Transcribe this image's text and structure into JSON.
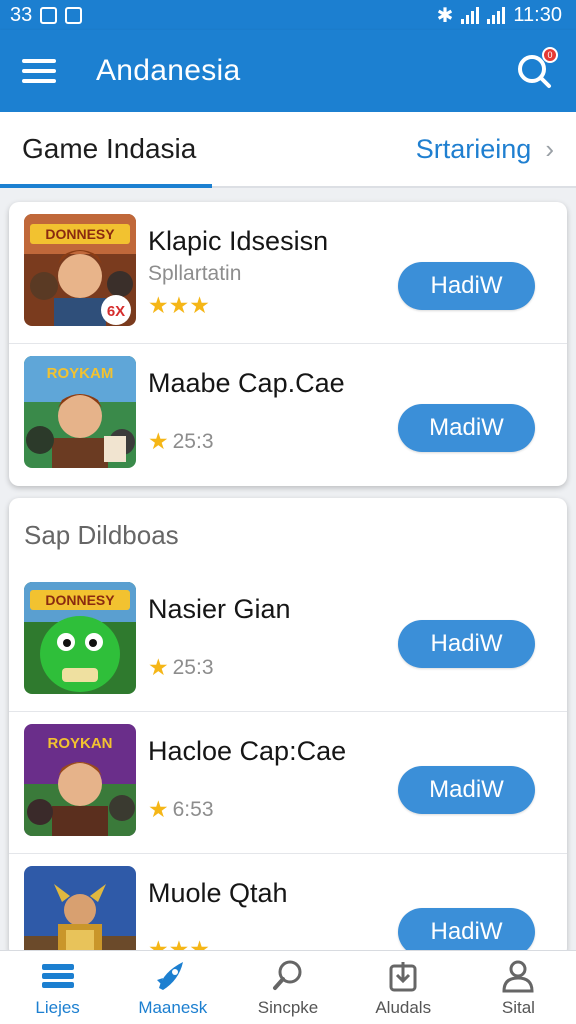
{
  "status": {
    "left_text": "33",
    "time": "11:30"
  },
  "appbar": {
    "title": "Andanesia",
    "badge": "0"
  },
  "tabbar": {
    "main_tab": "Game Indasia",
    "link": "Srtarieing"
  },
  "featured": [
    {
      "title": "Klapic Idsesisn",
      "subtitle": "Spllartatin",
      "stars": "★★★",
      "button": "HadiW",
      "thumb_label": "DONNESY",
      "thumb_badge": "6X"
    },
    {
      "title": "Maabe Cap.Cae",
      "rating": "25:3",
      "button": "MadiW",
      "thumb_label": "ROYKAM"
    }
  ],
  "section": {
    "title": "Sap Dildboas",
    "items": [
      {
        "title": "Nasier Gian",
        "rating": "25:3",
        "button": "HadiW",
        "thumb_label": "DONNESY"
      },
      {
        "title": "Hacloe Cap:Cae",
        "rating": "6:53",
        "button": "MadiW",
        "thumb_label": "ROYKAN"
      },
      {
        "title": "Muole Qtah",
        "stars": "★★★",
        "button": "HadiW"
      }
    ]
  },
  "bottom_nav": [
    {
      "label": "Liejes",
      "icon": "list-icon"
    },
    {
      "label": "Maanesk",
      "icon": "rocket-icon",
      "active": true
    },
    {
      "label": "Sincpke",
      "icon": "search-icon"
    },
    {
      "label": "Aludals",
      "icon": "download-icon"
    },
    {
      "label": "Sital",
      "icon": "person-icon"
    }
  ],
  "colors": {
    "primary": "#1c80d1",
    "button": "#3b8fd8",
    "star": "#f5b617",
    "badge": "#e53935"
  }
}
